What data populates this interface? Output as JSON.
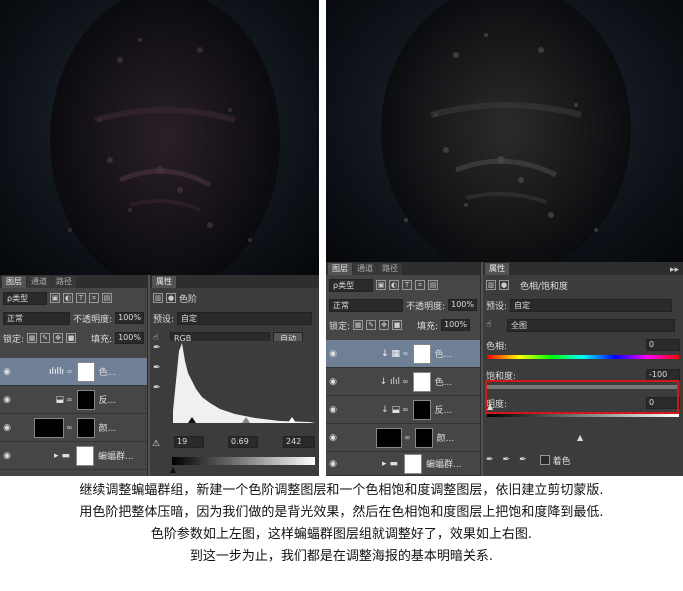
{
  "left": {
    "layers_panel": {
      "tabs": [
        "图层",
        "通道",
        "路径"
      ],
      "kind_filter": "ρ类型",
      "blend_mode": "正常",
      "opacity_label": "不透明度:",
      "opacity_value": "100%",
      "lock_label": "锁定:",
      "fill_label": "填充:",
      "fill_value": "100%",
      "layers": [
        {
          "name": "色...",
          "type": "levels"
        },
        {
          "name": "反...",
          "type": "invert"
        },
        {
          "name": "颜...",
          "type": "color"
        },
        {
          "name": "蝙蝠群...",
          "type": "group"
        }
      ]
    },
    "properties_panel": {
      "tab": "属性",
      "title": "色阶",
      "preset_label": "预设:",
      "preset_value": "自定",
      "channel": "RGB",
      "auto_button": "自动",
      "input_black": "19",
      "input_gamma": "0.69",
      "input_white": "242"
    }
  },
  "right": {
    "layers_panel": {
      "tabs": [
        "图层",
        "通道",
        "路径"
      ],
      "kind_filter": "ρ类型",
      "blend_mode": "正常",
      "opacity_label": "不透明度:",
      "opacity_value": "100%",
      "lock_label": "锁定:",
      "fill_label": "填充:",
      "fill_value": "100%",
      "layers": [
        {
          "name": "色...",
          "type": "hue"
        },
        {
          "name": "色...",
          "type": "levels"
        },
        {
          "name": "反...",
          "type": "invert"
        },
        {
          "name": "颜...",
          "type": "color"
        },
        {
          "name": "蝙蝠群...",
          "type": "group"
        }
      ]
    },
    "properties_panel": {
      "tab": "属性",
      "title": "色相/饱和度",
      "preset_label": "预设:",
      "preset_value": "自定",
      "range_value": "全图",
      "hue_label": "色相:",
      "hue_value": "0",
      "saturation_label": "饱和度:",
      "saturation_value": "-100",
      "lightness_label": "明度:",
      "lightness_value": "0",
      "colorize_label": "着色"
    }
  },
  "caption": [
    "继续调整蝙蝠群组，新建一个色阶调整图层和一个色相饱和度调整图层，依旧建立剪切蒙版.",
    "用色阶把整体压暗，因为我们做的是背光效果，然后在色相饱和度图层上把饱和度降到最低.",
    "色阶参数如上左图，这样蝙蝠群图层组就调整好了，效果如上右图.",
    "到这一步为止，我们都是在调整海报的基本明暗关系."
  ],
  "colors": {
    "highlight_box": "#d01818",
    "selected_layer": "#6f7f96"
  }
}
